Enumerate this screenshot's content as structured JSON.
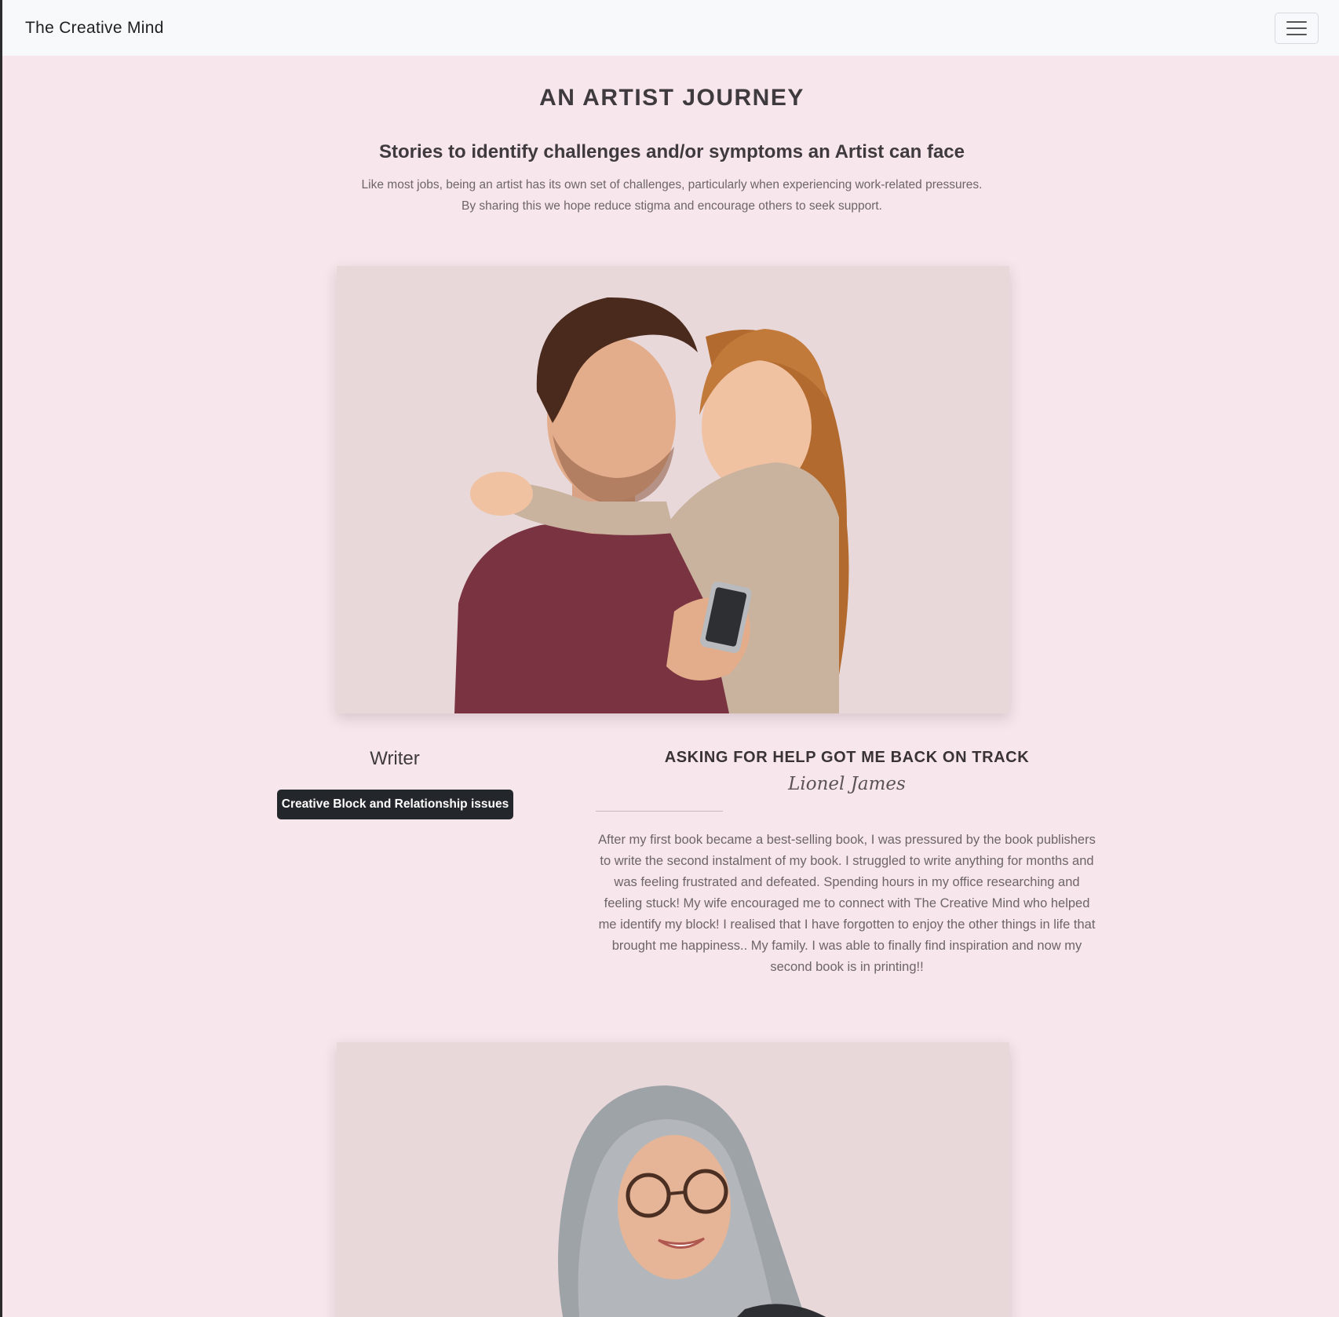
{
  "navbar": {
    "brand": "The Creative Mind",
    "toggle_icon": "hamburger-menu-icon"
  },
  "hero": {
    "title": "AN ARTIST JOURNEY",
    "subtitle_parts": [
      "Stories to ",
      "identify challenges",
      " and/or ",
      "symptoms",
      " an Artist can face"
    ],
    "description_line1": "Like most jobs, being an artist has its own set of challenges, particularly when experiencing work-related pressures.",
    "description_line2": "By sharing this we hope reduce stigma and encourage others to seek support."
  },
  "stories": [
    {
      "role": "Writer",
      "tag": "Creative Block and Relationship issues",
      "title": "ASKING FOR HELP GOT ME BACK ON TRACK",
      "author": "Lionel James",
      "body": "After my first book became a best-selling book, I was pressured by the book publishers to write the second instalment of my book. I struggled to write anything for months and was feeling frustrated and defeated. Spending hours in my office researching and feeling stuck! My wife encouraged me to connect with The Creative Mind who helped me identify my block! I realised that I have forgotten to enjoy the other things in life that brought me happiness.. My family. I was able to finally find inspiration and now my second book is in printing!!"
    }
  ],
  "colors": {
    "page_bg": "#f7e6ec",
    "navbar_bg": "#f8f9fb",
    "badge_bg": "#23262a",
    "photo_bg": "#e8d8da"
  }
}
